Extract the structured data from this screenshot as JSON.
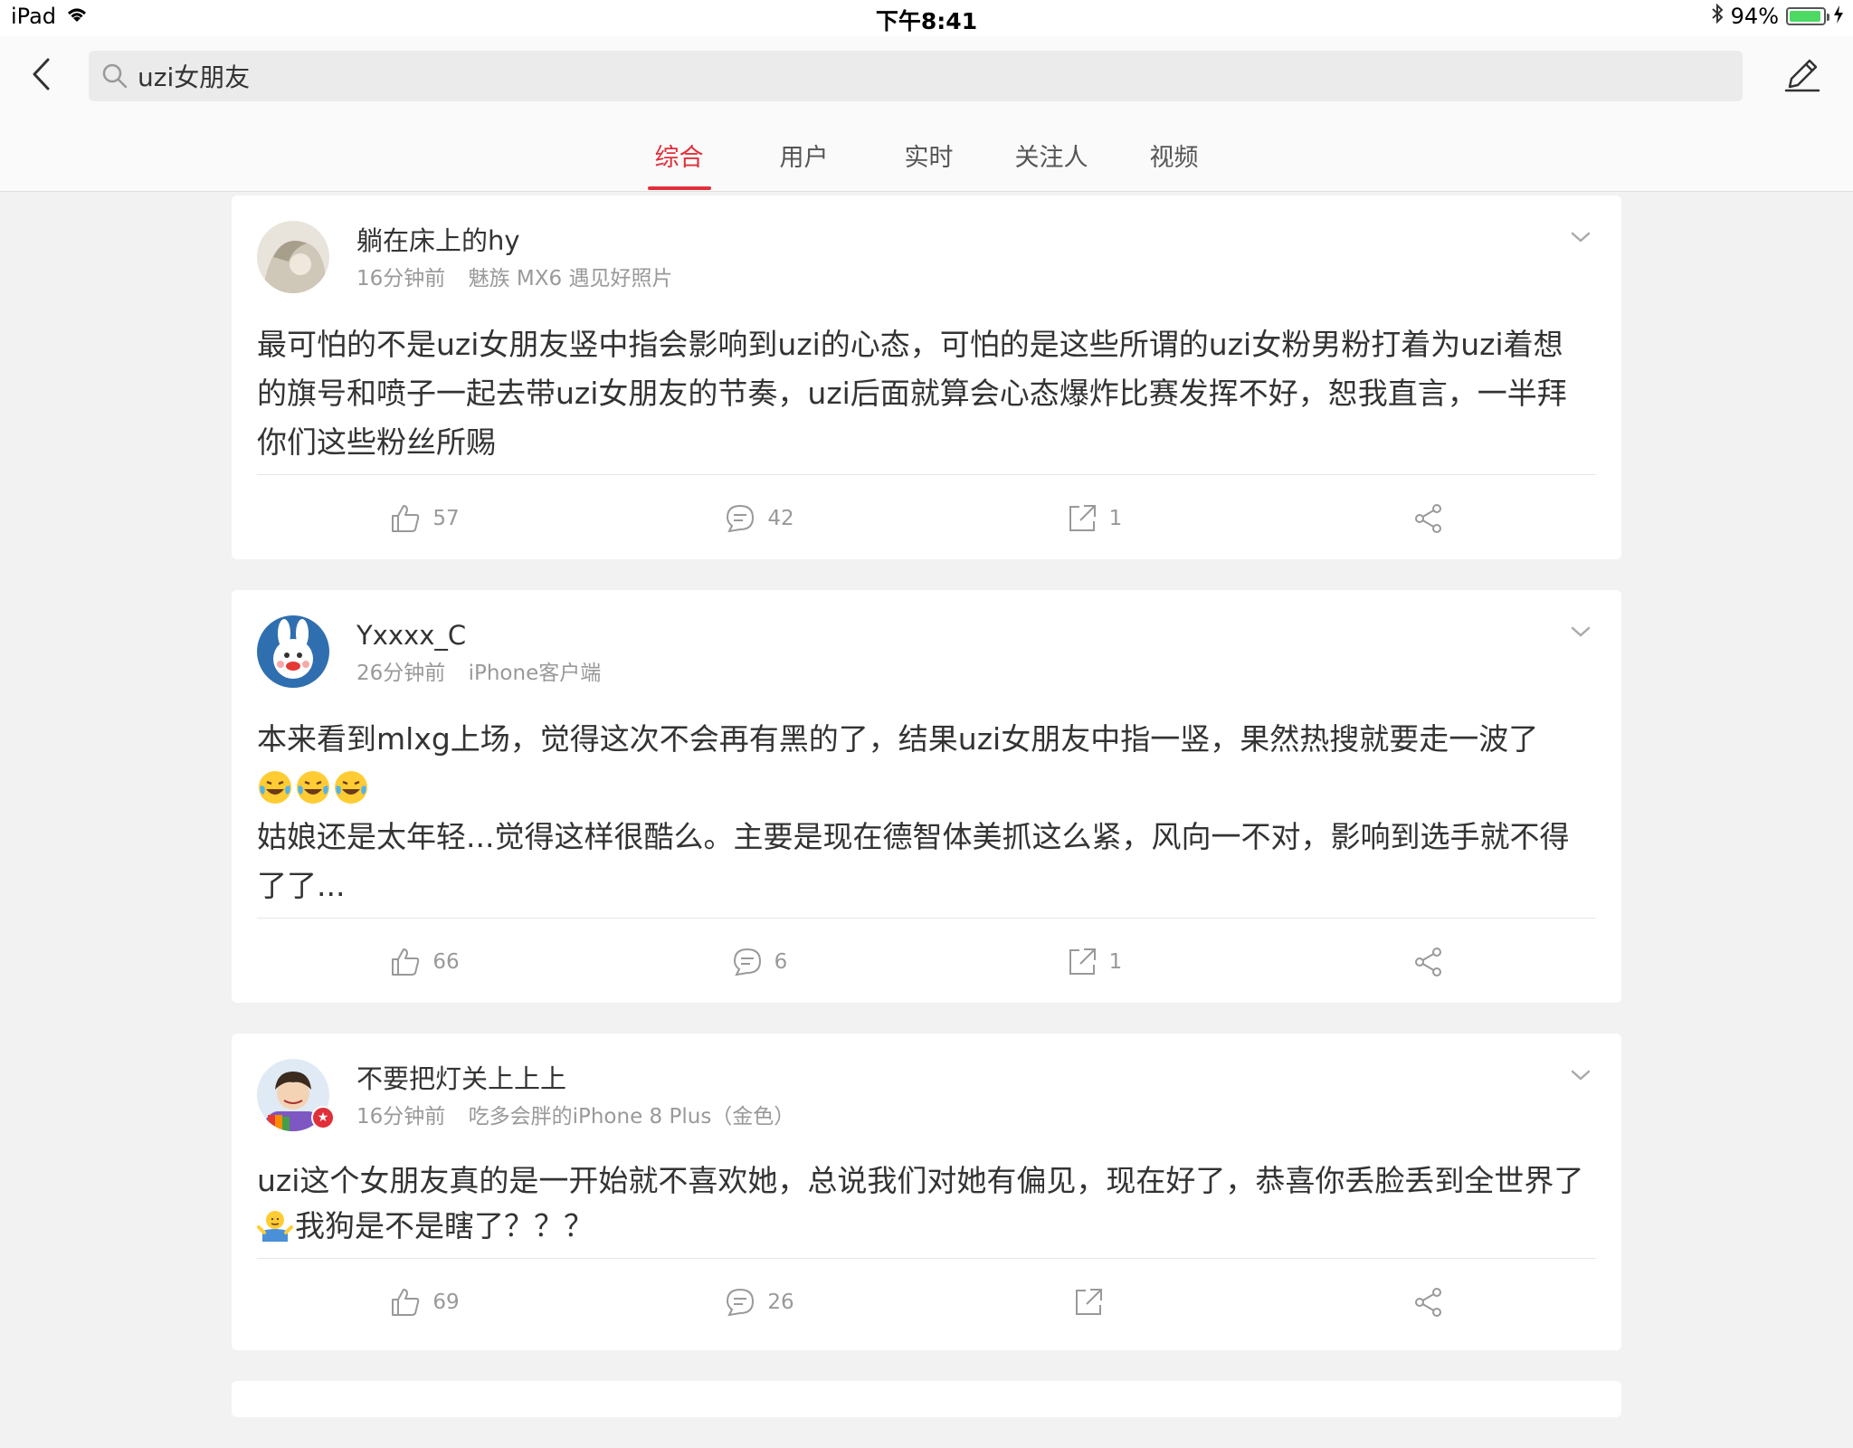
{
  "status_bar": {
    "device": "iPad",
    "time": "下午8:41",
    "battery": "94%",
    "battery_level": 0.94
  },
  "header": {
    "search": {
      "value": "uzi女朋友",
      "icon": "search-icon"
    },
    "back_icon": "back-icon",
    "compose_icon": "compose-icon"
  },
  "tabs": [
    {
      "label": "综合",
      "active": true
    },
    {
      "label": "用户",
      "active": false
    },
    {
      "label": "实时",
      "active": false
    },
    {
      "label": "关注人",
      "active": false
    },
    {
      "label": "视频",
      "active": false
    }
  ],
  "posts": [
    {
      "user": "躺在床上的hy",
      "time": "16分钟前",
      "source": "魅族 MX6 遇见好照片",
      "text": "最可怕的不是uzi女朋友竖中指会影响到uzi的心态，可怕的是这些所谓的uzi女粉男粉打着为uzi着想的旗号和喷子一起去带uzi女朋友的节奏，uzi后面就算会心态爆炸比赛发挥不好，恕我直言，一半拜你们这些粉丝所赐",
      "likes": "57",
      "comments": "42",
      "reposts": "1"
    },
    {
      "user": "Yxxxx_C",
      "time": "26分钟前",
      "source": "iPhone客户端",
      "text1": "本来看到mlxg上场，觉得这次不会再有黑的了，结果uzi女朋友中指一竖，果然热搜就要走一波了",
      "text2": "姑娘还是太年轻...觉得这样很酷么。主要是现在德智体美抓这么紧，风向一不对，影响到选手就不得了了...",
      "likes": "66",
      "comments": "6",
      "reposts": "1"
    },
    {
      "user": "不要把灯关上上上",
      "time": "16分钟前",
      "source": "吃多会胖的iPhone 8 Plus（金色）",
      "text1": "uzi这个女朋友真的是一开始就不喜欢她，总说我们对她有偏见，现在好了，恭喜你丢脸丢到全世界了",
      "text2": "我狗是不是瞎了？？？",
      "likes": "69",
      "comments": "26",
      "reposts": ""
    }
  ],
  "colors": {
    "accent": "#e0303a",
    "background": "#f2f2f2",
    "card": "#ffffff",
    "meta_text": "#999999"
  }
}
